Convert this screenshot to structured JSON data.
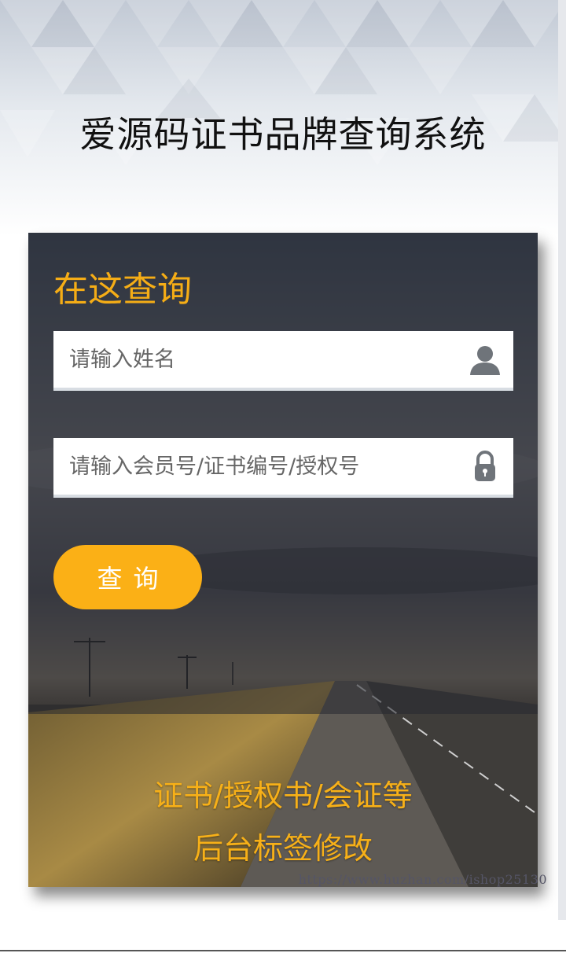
{
  "header": {
    "title": "爱源码证书品牌查询系统"
  },
  "form": {
    "heading": "在这查询",
    "name_field": {
      "placeholder": "请输入姓名",
      "value": "",
      "icon": "user-icon"
    },
    "id_field": {
      "placeholder": "请输入会员号/证书编号/授权号",
      "value": "",
      "icon": "lock-icon"
    },
    "submit_label": "查询"
  },
  "promo": {
    "line1": "证书/授权书/会证等",
    "line2": "后台标签修改"
  },
  "watermark": "https://www.huzhan.com/ishop25130",
  "colors": {
    "accent": "#fbb016",
    "heading": "#f5ad16",
    "title": "#111111"
  }
}
